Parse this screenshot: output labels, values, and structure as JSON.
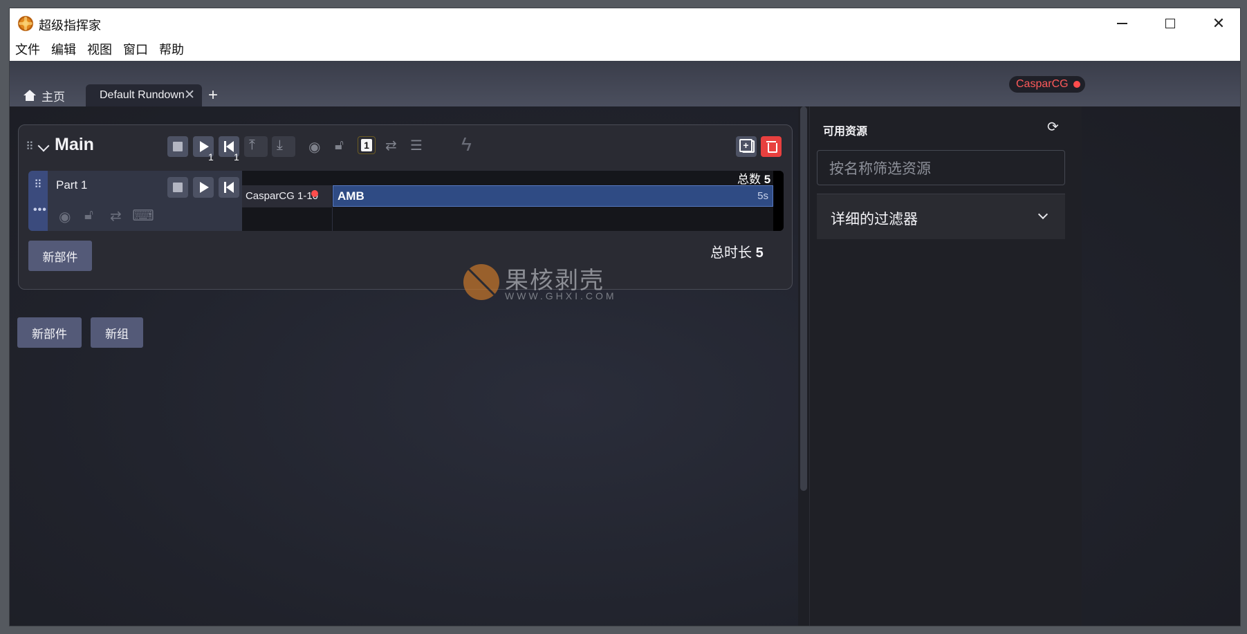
{
  "window": {
    "title": "超级指挥家"
  },
  "menu": [
    "文件",
    "编辑",
    "视图",
    "窗口",
    "帮助"
  ],
  "tabs": {
    "home_label": "主页",
    "active_label": "Default Rundown",
    "add_label": "+"
  },
  "server_badge": {
    "label": "CasparCG",
    "status_color": "#ff4d4d"
  },
  "group": {
    "name": "Main",
    "play_counter": "1",
    "back_counter": "1",
    "channel_number": "1",
    "new_part_label": "新部件",
    "total_duration_label": "总时长",
    "total_duration_value": "5",
    "part": {
      "name": "Part 1",
      "layer_label": "CasparCG 1-10",
      "clip_name": "AMB",
      "clip_duration": "5s",
      "count_label": "总数",
      "count_value": "5"
    }
  },
  "footer_buttons": {
    "new_part": "新部件",
    "new_group": "新组"
  },
  "resources": {
    "title": "可用资源",
    "filter_placeholder": "按名称筛选资源",
    "detailed_filter_label": "详细的过滤器"
  },
  "watermark": {
    "title": "果核剥壳",
    "url": "WWW.GHXI.COM"
  },
  "colors": {
    "accent": "#545a78",
    "danger": "#e8403f",
    "clip": "#2f4b84"
  }
}
